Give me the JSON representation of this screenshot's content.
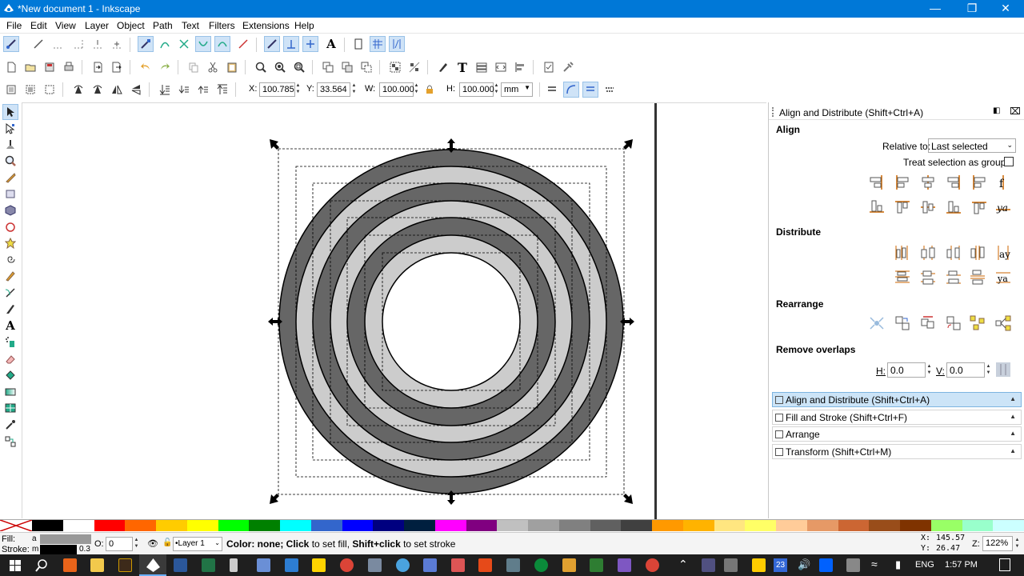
{
  "window": {
    "title": "*New document 1 - Inkscape"
  },
  "menu": [
    "File",
    "Edit",
    "View",
    "Layer",
    "Object",
    "Path",
    "Text",
    "Filters",
    "Extensions",
    "Help"
  ],
  "toolbar3": {
    "x_label": "X:",
    "x_value": "100.785",
    "y_label": "Y:",
    "y_value": "33.564",
    "w_label": "W:",
    "w_value": "100.000",
    "h_label": "H:",
    "h_value": "100.000",
    "unit": "mm"
  },
  "panel": {
    "title": "Align and Distribute (Shift+Ctrl+A)",
    "align_heading": "Align",
    "relative_label": "Relative to:",
    "relative_value": "Last selected",
    "treat_group_label": "Treat selection as group:",
    "distribute_heading": "Distribute",
    "rearrange_heading": "Rearrange",
    "remove_overlaps_heading": "Remove overlaps",
    "h_label": "H:",
    "h_value": "0.0",
    "v_label": "V:",
    "v_value": "0.0",
    "docked": [
      "Align and Distribute (Shift+Ctrl+A)",
      "Fill and Stroke (Shift+Ctrl+F)",
      "Arrange",
      "Transform (Shift+Ctrl+M)"
    ]
  },
  "status": {
    "fill_label": "Fill:",
    "fill_value": "a",
    "stroke_label": "Stroke:",
    "stroke_value": "m",
    "stroke_width": "0.3",
    "opacity_label": "O:",
    "opacity_value": "0",
    "layer": "•Layer 1",
    "message_bold1": "Color: none;",
    "message_bold2": "Click",
    "message_mid": " to set fill, ",
    "message_bold3": "Shift+click",
    "message_end": " to set stroke",
    "cursor_x_label": "X:",
    "cursor_x": "145.57",
    "cursor_y_label": "Y:",
    "cursor_y": "26.47",
    "zoom_label": "Z:",
    "zoom": "122%"
  },
  "taskbar": {
    "lang": "ENG",
    "time": "1:57 PM",
    "badge": "23"
  },
  "palette": [
    "#000000",
    "#ffffff",
    "#ff0000",
    "#ff6600",
    "#ffcc00",
    "#ffff00",
    "#00ff00",
    "#008000",
    "#00ffff",
    "#3366cc",
    "#0000ff",
    "#000080",
    "#001f3f",
    "#ff00ff",
    "#800080",
    "#c0c0c0",
    "#a0a0a0",
    "#808080",
    "#606060",
    "#404040",
    "#ff9900",
    "#ffb300",
    "#ffe680",
    "#ffff66",
    "#ffcc99",
    "#e69966",
    "#cc6633",
    "#994d1a",
    "#7f3300",
    "#99ff66",
    "#99ffcc",
    "#ccffff"
  ]
}
